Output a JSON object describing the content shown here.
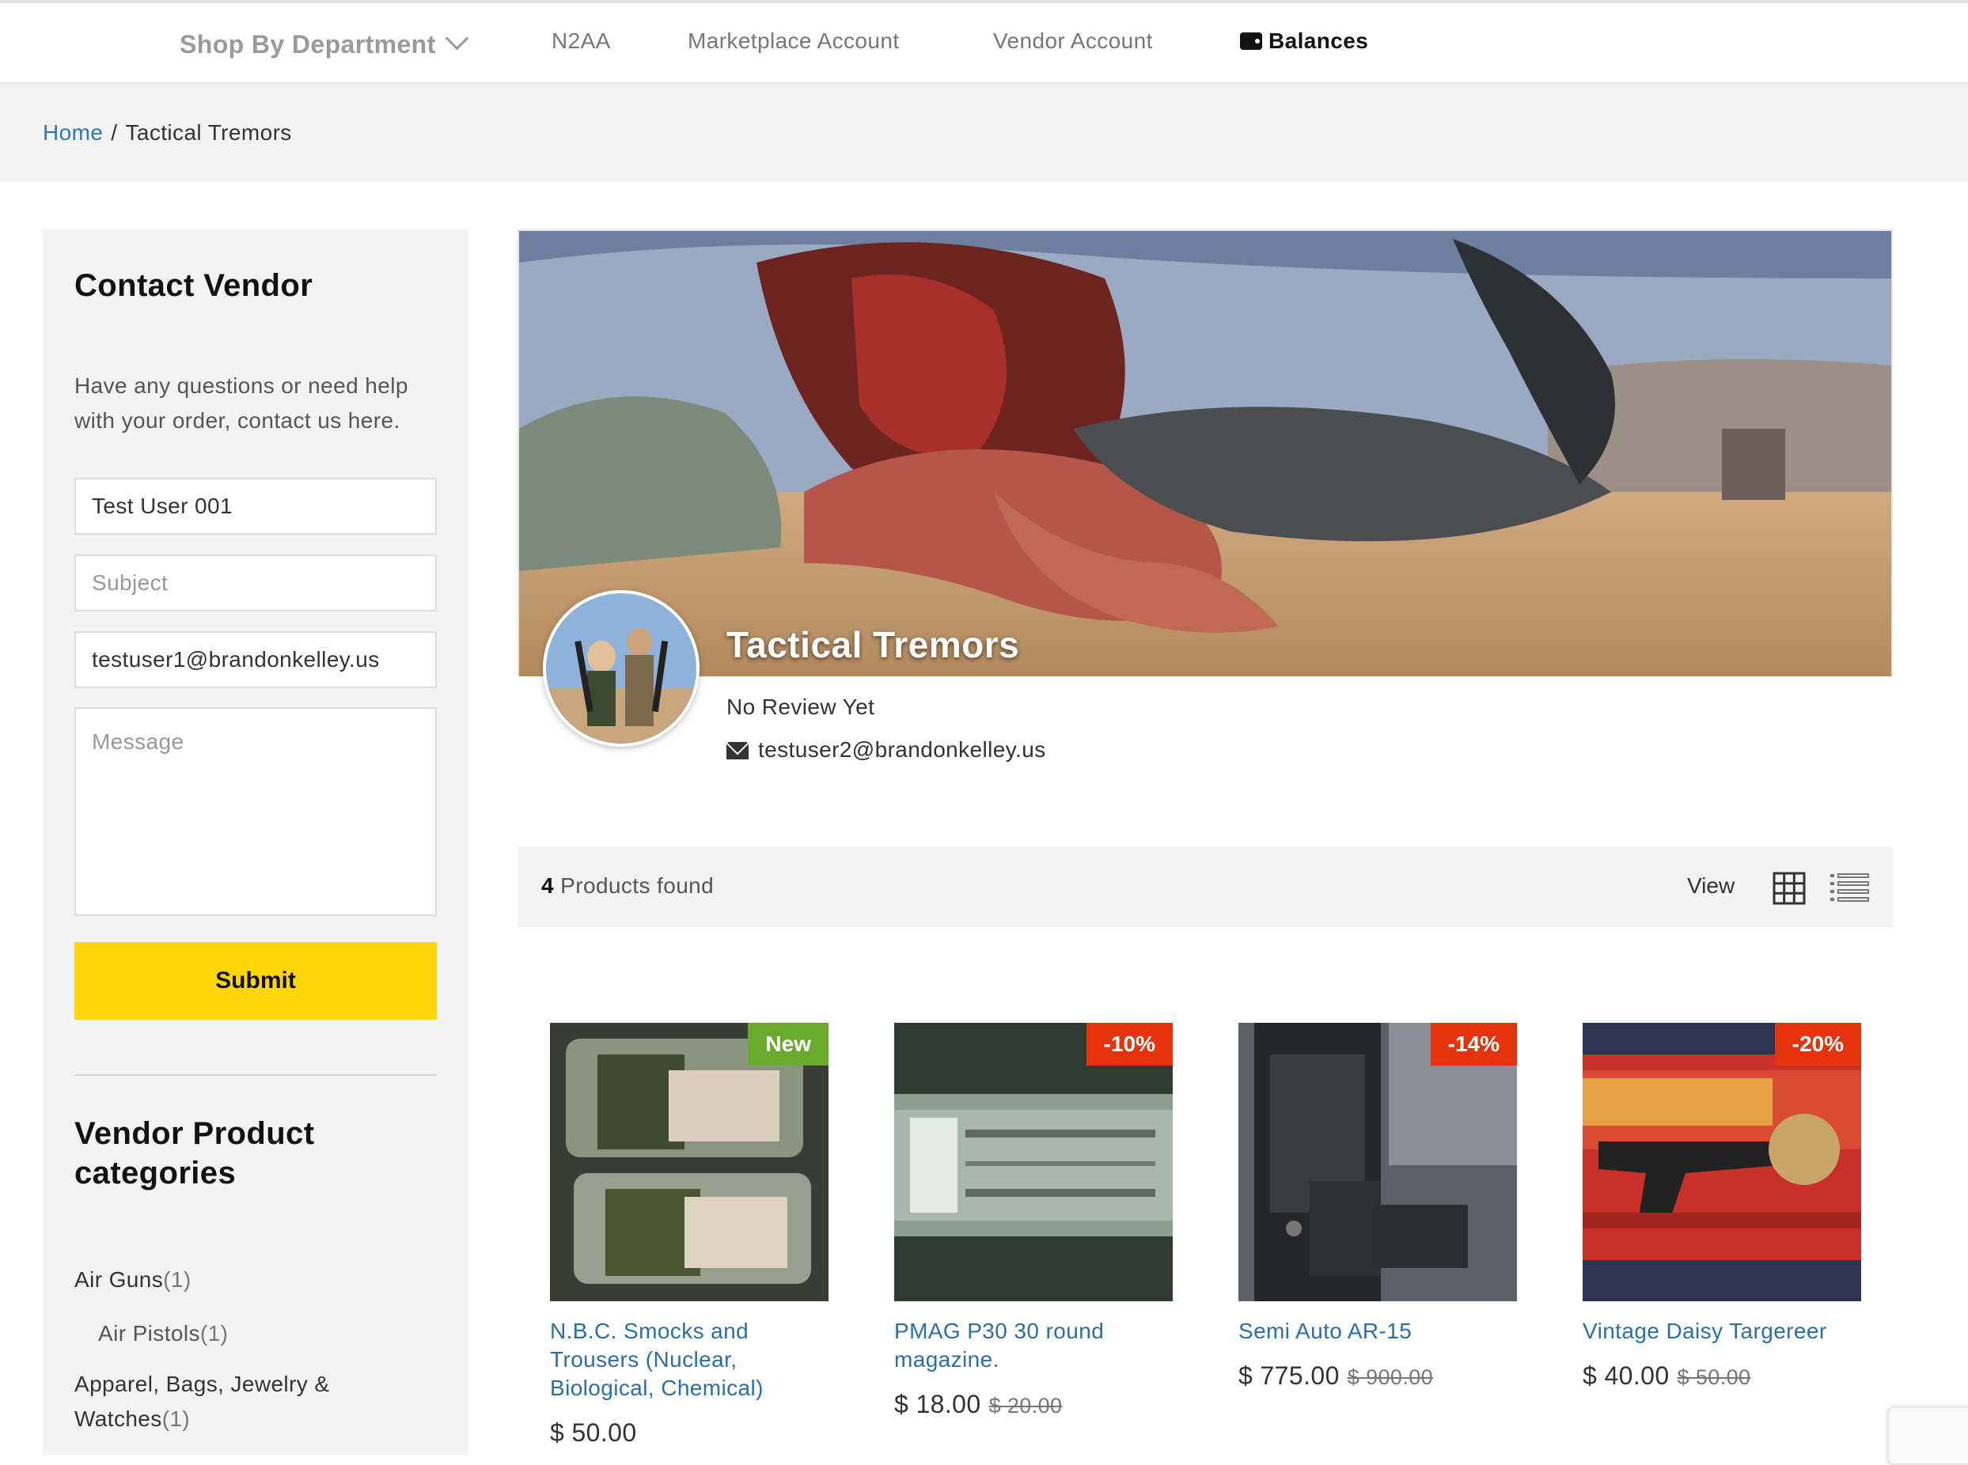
{
  "nav": {
    "department": "Shop By Department",
    "items": [
      "N2AA",
      "Marketplace Account",
      "Vendor Account"
    ],
    "balances": "Balances",
    "icons": {
      "department": "chevron-down-icon",
      "balances": "wallet-icon"
    }
  },
  "breadcrumb": {
    "home": "Home",
    "separator": "/",
    "current": "Tactical Tremors"
  },
  "contact": {
    "title": "Contact Vendor",
    "description": "Have any questions or need help with your order, contact us here.",
    "name_value": "Test User 001",
    "subject_placeholder": "Subject",
    "email_value": "testuser1@brandonkelley.us",
    "message_placeholder": "Message",
    "submit_label": "Submit",
    "submit_color": "#ffd60a"
  },
  "categories": {
    "title": "Vendor Product categories",
    "items": [
      {
        "name": "Air Guns",
        "count": "(1)"
      },
      {
        "name": "Air Pistols",
        "count": "(1)"
      },
      {
        "name": "Apparel, Bags, Jewelry & Watches",
        "count": "(1)"
      }
    ]
  },
  "vendor": {
    "name": "Tactical Tremors",
    "review": "No Review Yet",
    "email": "testuser2@brandonkelley.us"
  },
  "toolbar": {
    "count": "4",
    "found_text": "Products found",
    "view_label": "View",
    "icons": [
      "grid-view-icon",
      "list-view-icon"
    ]
  },
  "products": [
    {
      "badge": "New",
      "name": "N.B.C. Smocks and Trousers (Nuclear, Biological, Chemical)",
      "price": "$ 50.00",
      "old_price": ""
    },
    {
      "badge": "-10%",
      "name": "PMAG P30 30 round magazine.",
      "price": "$ 18.00",
      "old_price": "$ 20.00"
    },
    {
      "badge": "-14%",
      "name": "Semi Auto AR-15",
      "price": "$ 775.00",
      "old_price": "$ 900.00"
    },
    {
      "badge": "-20%",
      "name": "Vintage Daisy Targereer",
      "price": "$ 40.00",
      "old_price": "$ 50.00"
    }
  ],
  "colors": {
    "link": "#2a6fa8",
    "badge_new": "#6aab2e",
    "badge_sale": "#e6330e",
    "panel_bg": "#f3f3f3"
  }
}
